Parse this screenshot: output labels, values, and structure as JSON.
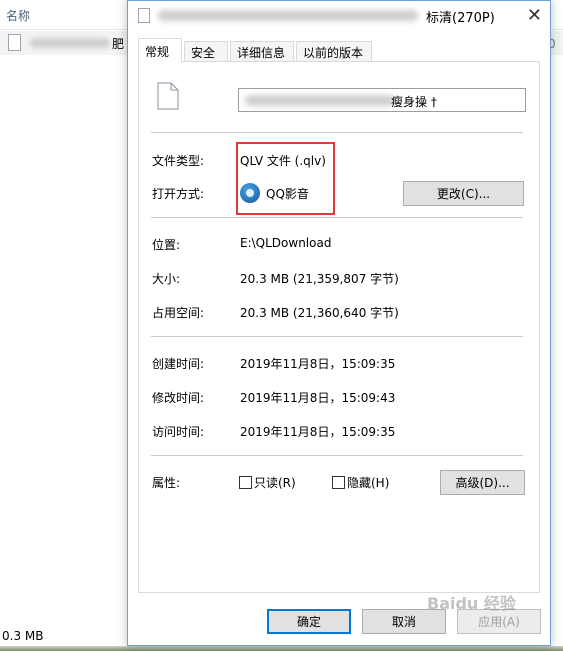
{
  "explorer": {
    "column_name": "名称",
    "file_name_suffix": "肥",
    "right_edge_text": "0",
    "status_size": "0.3 MB"
  },
  "dialog": {
    "title_suffix": "标清(270P)",
    "close_glyph": "✕",
    "tabs": [
      {
        "label": "常规",
        "active": true
      },
      {
        "label": "安全",
        "active": false
      },
      {
        "label": "详细信息",
        "active": false
      },
      {
        "label": "以前的版本",
        "active": false
      }
    ],
    "file_name_visible": "瘦身操 †",
    "file_type": {
      "label": "文件类型:",
      "value": "QLV 文件 (.qlv)"
    },
    "open_with": {
      "label": "打开方式:",
      "value": "QQ影音",
      "icon": "qq-player-icon"
    },
    "change_button": "更改(C)...",
    "location": {
      "label": "位置:",
      "value": "E:\\QLDownload"
    },
    "size": {
      "label": "大小:",
      "value": "20.3 MB (21,359,807 字节)"
    },
    "size_on_disk": {
      "label": "占用空间:",
      "value": "20.3 MB (21,360,640 字节)"
    },
    "created": {
      "label": "创建时间:",
      "value": "2019年11月8日，15:09:35"
    },
    "modified": {
      "label": "修改时间:",
      "value": "2019年11月8日，15:09:43"
    },
    "accessed": {
      "label": "访问时间:",
      "value": "2019年11月8日，15:09:35"
    },
    "attributes": {
      "label": "属性:",
      "readonly": {
        "label": "只读(R)",
        "checked": false
      },
      "hidden": {
        "label": "隐藏(H)",
        "checked": false
      },
      "advanced_button": "高级(D)..."
    },
    "ok_button": "确定",
    "cancel_button": "取消",
    "apply_button": "应用(A)"
  },
  "watermark": "Baidu 经验",
  "colors": {
    "accent": "#0078d7",
    "highlight_box": "#e23a3a",
    "dialog_border": "#6f9fd8"
  }
}
